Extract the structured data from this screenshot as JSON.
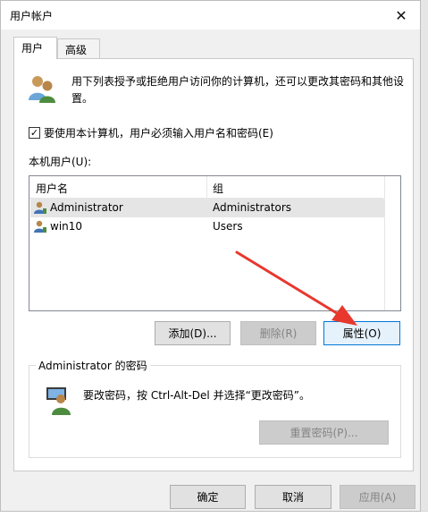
{
  "window": {
    "title": "用户帐户"
  },
  "tabs": [
    {
      "label": "用户",
      "active": true
    },
    {
      "label": "高级",
      "active": false
    }
  ],
  "intro_text": "用下列表授予或拒绝用户访问你的计算机，还可以更改其密码和其他设置。",
  "require_login": {
    "label": "要使用本计算机，用户必须输入用户名和密码(E)",
    "checked": true
  },
  "users_label": "本机用户(U):",
  "users_table": {
    "columns": [
      "用户名",
      "组"
    ],
    "rows": [
      {
        "name": "Administrator",
        "group": "Administrators",
        "selected": true
      },
      {
        "name": "win10",
        "group": "Users",
        "selected": false
      }
    ]
  },
  "buttons": {
    "add": "添加(D)...",
    "remove": "删除(R)",
    "properties": "属性(O)",
    "reset_password": "重置密码(P)...",
    "ok": "确定",
    "cancel": "取消",
    "apply": "应用(A)"
  },
  "password_group": {
    "title": "Administrator 的密码",
    "text": "要改密码，按 Ctrl-Alt-Del 并选择“更改密码”。"
  },
  "icons": {
    "close": "close-icon",
    "users": "users-icon",
    "user": "user-icon",
    "password_user": "user-password-icon"
  },
  "colors": {
    "accent": "#0078d7",
    "selection": "#e5e5e5",
    "annotation_arrow": "#e8372d"
  }
}
